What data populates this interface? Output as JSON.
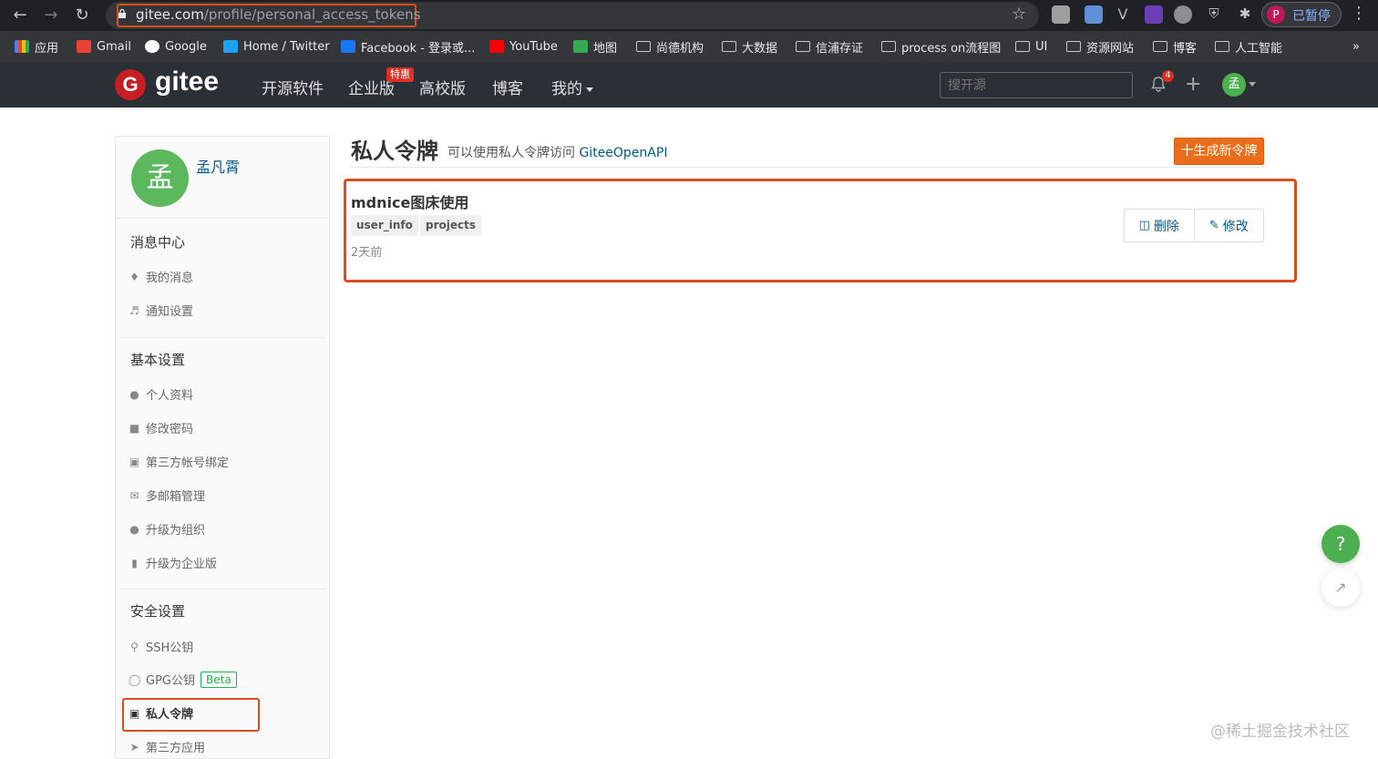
{
  "browser": {
    "url_host": "gitee.com",
    "url_path": "/profile/personal_access_tokens",
    "profile_initial": "P",
    "profile_label": "已暂停",
    "bookmarks": [
      "应用",
      "Gmail",
      "Google",
      "Home / Twitter",
      "Facebook - 登录或...",
      "YouTube",
      "地图",
      "尚德机构",
      "大数据",
      "信浦存证",
      "process on流程图",
      "UI",
      "资源网站",
      "博客",
      "人工智能"
    ],
    "more_label": "»"
  },
  "header": {
    "logo_mark": "G",
    "logo_text": "gitee",
    "nav": [
      "开源软件",
      "企业版",
      "高校版",
      "博客",
      "我的"
    ],
    "promo_badge": "特惠",
    "search_placeholder": "搜开源",
    "notification_count": "4",
    "user_initial": "孟"
  },
  "sidebar": {
    "avatar_initial": "孟",
    "username": "孟凡霄",
    "sections": [
      {
        "title": "消息中心",
        "items": [
          "我的消息",
          "通知设置"
        ]
      },
      {
        "title": "基本设置",
        "items": [
          "个人资料",
          "修改密码",
          "第三方帐号绑定",
          "多邮箱管理",
          "升级为组织",
          "升级为企业版"
        ]
      },
      {
        "title": "安全设置",
        "items": [
          "SSH公钥",
          "GPG公钥",
          "私人令牌",
          "第三方应用"
        ]
      }
    ],
    "beta_label": "Beta"
  },
  "main": {
    "title": "私人令牌",
    "subtitle": "可以使用私人令牌访问 ",
    "subtitle_link": "GiteeOpenAPI",
    "generate_button": "十生成新令牌",
    "token": {
      "name": "mdnice图床使用",
      "scopes": [
        "user_info",
        "projects"
      ],
      "time": "2天前",
      "delete_label": "删除",
      "edit_label": "修改"
    }
  },
  "floating": {
    "help": "?",
    "watermark": "@稀土掘金技术社区"
  }
}
